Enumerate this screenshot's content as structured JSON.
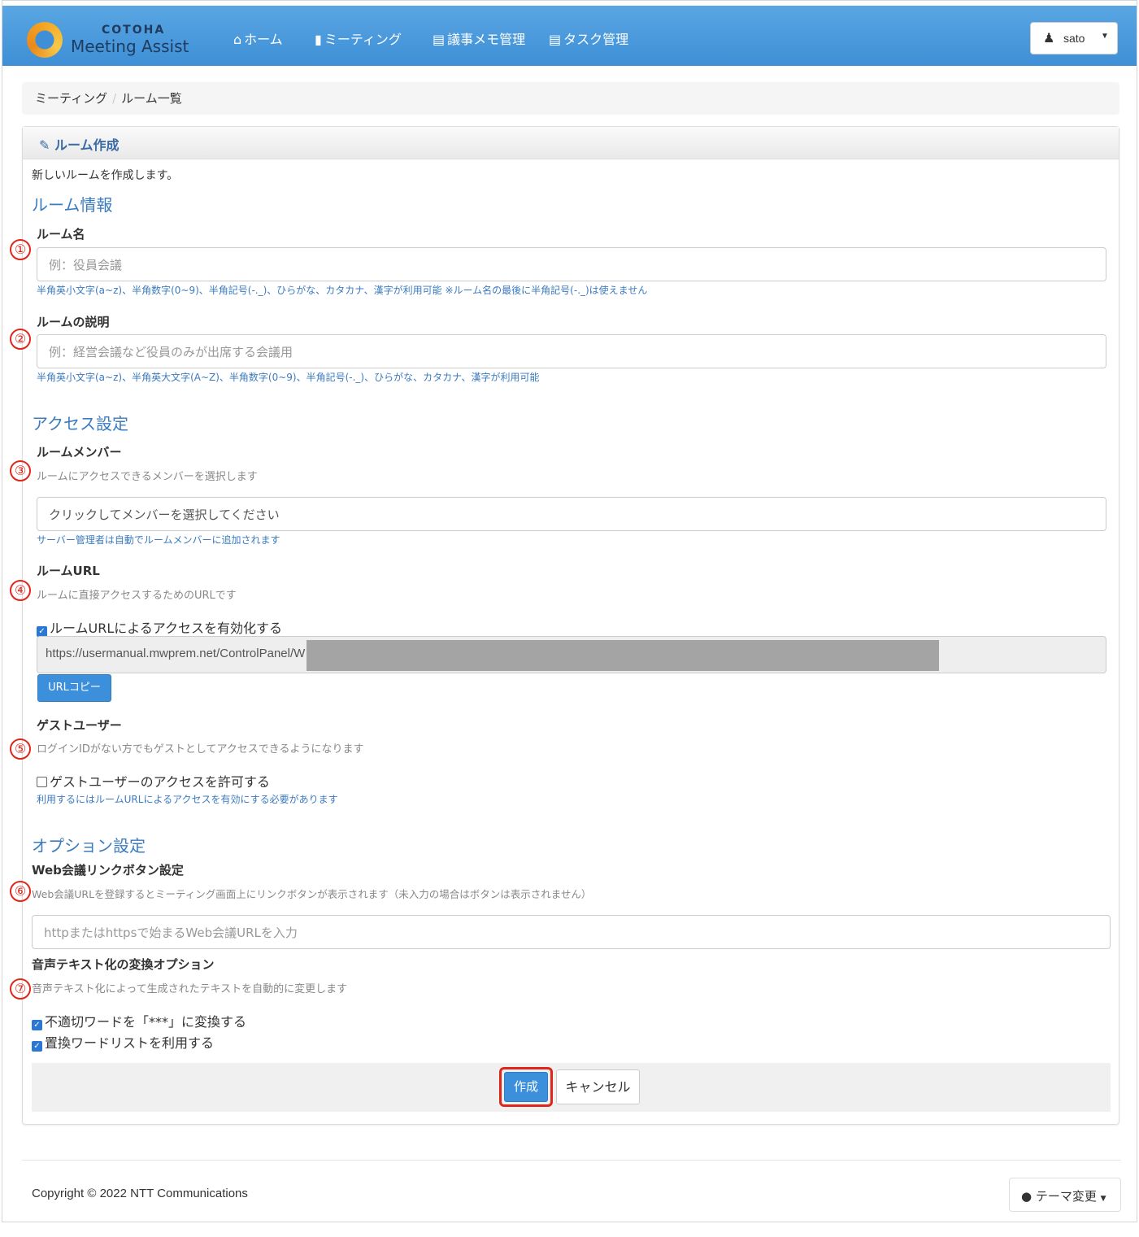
{
  "navbar": {
    "logo_top": "COTOHA",
    "logo_main": "Meeting Assist",
    "items": [
      {
        "icon": "home-icon",
        "label": "ホーム"
      },
      {
        "icon": "chat-icon",
        "label": "ミーティング"
      },
      {
        "icon": "notes-icon",
        "label": "議事メモ管理"
      },
      {
        "icon": "tasks-icon",
        "label": "タスク管理"
      }
    ],
    "user": "sato"
  },
  "breadcrumb": [
    "ミーティング",
    "ルーム一覧"
  ],
  "panel": {
    "title": "ルーム作成",
    "description": "新しいルームを作成します。",
    "room_info": {
      "section_title": "ルーム情報",
      "name_label": "ルーム名",
      "name_placeholder": "例：役員会議",
      "name_help": "半角英小文字(a~z)、半角数字(0~9)、半角記号(-._)、ひらがな、カタカナ、漢字が利用可能 ※ルーム名の最後に半角記号(-._)は使えません",
      "desc_label": "ルームの説明",
      "desc_placeholder": "例：経営会議など役員のみが出席する会議用",
      "desc_help": "半角英小文字(a~z)、半角英大文字(A~Z)、半角数字(0~9)、半角記号(-._)、ひらがな、カタカナ、漢字が利用可能"
    },
    "access": {
      "section_title": "アクセス設定",
      "members_label": "ルームメンバー",
      "members_sub": "ルームにアクセスできるメンバーを選択します",
      "members_placeholder": "クリックしてメンバーを選択してください",
      "members_help": "サーバー管理者は自動でルームメンバーに追加されます",
      "url_label": "ルームURL",
      "url_sub": "ルームに直接アクセスするためのURLです",
      "url_checkbox": "ルームURLによるアクセスを有効化する",
      "url_checked": true,
      "url_value": "https://usermanual.mwprem.net/ControlPanel/W",
      "url_copy_button": "URLコピー",
      "guest_label": "ゲストユーザー",
      "guest_sub": "ログインIDがない方でもゲストとしてアクセスできるようになります",
      "guest_checkbox": "ゲストユーザーのアクセスを許可する",
      "guest_checked": false,
      "guest_help": "利用するにはルームURLによるアクセスを有効にする必要があります"
    },
    "options": {
      "section_title": "オプション設定",
      "web_label": "Web会議リンクボタン設定",
      "web_sub": "Web会議URLを登録するとミーティング画面上にリンクボタンが表示されます（未入力の場合はボタンは表示されません）",
      "web_placeholder": "httpまたはhttpsで始まるWeb会議URLを入力",
      "speech_label": "音声テキスト化の変換オプション",
      "speech_sub": "音声テキスト化によって生成されたテキストを自動的に変更します",
      "option1": "不適切ワードを「***」に変換する",
      "option1_checked": true,
      "option2": "置換ワードリストを利用する",
      "option2_checked": true
    },
    "create_button": "作成",
    "cancel_button": "キャンセル"
  },
  "markers": [
    "①",
    "②",
    "③",
    "④",
    "⑤",
    "⑥",
    "⑦"
  ],
  "footer": {
    "copyright": "Copyright © 2022 NTT Communications",
    "theme_button": "テーマ変更"
  },
  "colors": {
    "navbar": "#4a9ae0",
    "accent_blue": "#3b7bbf",
    "primary_button": "#3b8fdb",
    "highlight_red": "#e0261b"
  }
}
